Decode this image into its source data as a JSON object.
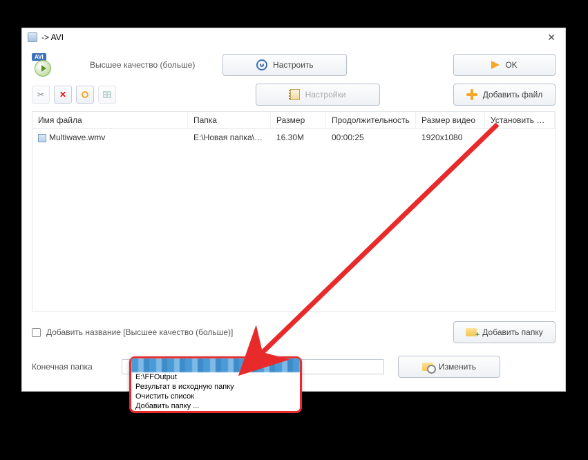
{
  "title": "-> AVI",
  "quality_text": "Высшее качество (больше)",
  "buttons": {
    "configure": "Настроить",
    "ok": "OK",
    "settings": "Настройки",
    "add_file": "Добавить файл",
    "add_folder": "Добавить папку",
    "change": "Изменить"
  },
  "columns": {
    "filename": "Имя файла",
    "folder": "Папка",
    "size": "Размер",
    "duration": "Продолжительность",
    "video_size": "Размер видео",
    "set_range": "Установить диапаз..."
  },
  "rows": [
    {
      "filename": "Multiwave.wmv",
      "folder": "E:\\Новая папка\\FI...",
      "size": "16.30M",
      "duration": "00:00:25",
      "video_size": "1920x1080",
      "range": ""
    }
  ],
  "add_title_label": "Добавить название [Высшее качество (больше)]",
  "dest_label": "Конечная папка",
  "popup": {
    "items": [
      "E:\\FFOutput",
      "Результат в исходную папку",
      "Очистить список",
      "Добавить папку ..."
    ]
  }
}
